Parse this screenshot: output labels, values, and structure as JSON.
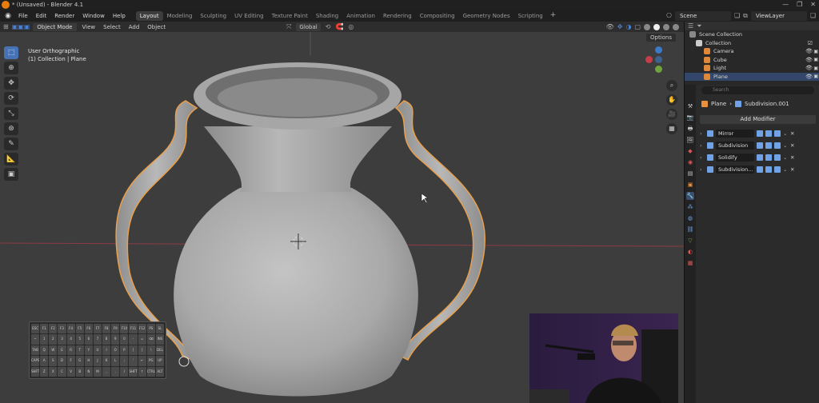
{
  "window": {
    "title": "* (Unsaved) - Blender 4.1",
    "controls": [
      "—",
      "❐",
      "✕"
    ]
  },
  "menu": [
    "File",
    "Edit",
    "Render",
    "Window",
    "Help"
  ],
  "workspaces": {
    "tabs": [
      "Layout",
      "Modeling",
      "Sculpting",
      "UV Editing",
      "Texture Paint",
      "Shading",
      "Animation",
      "Rendering",
      "Compositing",
      "Geometry Nodes",
      "Scripting"
    ],
    "active": "Layout",
    "add": "+"
  },
  "scene": {
    "label": "Scene",
    "view_layer": "ViewLayer"
  },
  "viewport_header": {
    "mode": "Object Mode",
    "menus": [
      "View",
      "Select",
      "Add",
      "Object"
    ],
    "transform_orientation": "Global",
    "options": "Options"
  },
  "viewport": {
    "view_name": "User Orthographic",
    "collection_info": "(1) Collection | Plane"
  },
  "keyboard": {
    "keys": [
      "ESC",
      "F1",
      "F2",
      "F3",
      "F4",
      "F5",
      "F6",
      "F7",
      "F8",
      "F9",
      "F10",
      "F11",
      "F12",
      "PS",
      "SL",
      "~",
      "1",
      "2",
      "3",
      "4",
      "5",
      "6",
      "7",
      "8",
      "9",
      "0",
      "-",
      "=",
      "⌫",
      "INS",
      "TAB",
      "Q",
      "W",
      "E",
      "R",
      "T",
      "Y",
      "U",
      "I",
      "O",
      "P",
      "[",
      "]",
      "\\",
      "DEL",
      "CAPS",
      "A",
      "S",
      "D",
      "F",
      "G",
      "H",
      "J",
      "K",
      "L",
      ";",
      "'",
      "↵",
      "PG",
      "UP",
      "SHFT",
      "Z",
      "X",
      "C",
      "V",
      "B",
      "N",
      "M",
      ",",
      ".",
      "/",
      "SHFT",
      "↑",
      "CTRL",
      "ALT"
    ]
  },
  "outliner": {
    "root": "Scene Collection",
    "collection": "Collection",
    "items": [
      {
        "name": "Camera",
        "color": "#e0883a"
      },
      {
        "name": "Cube",
        "color": "#e0883a"
      },
      {
        "name": "Light",
        "color": "#e0883a"
      },
      {
        "name": "Plane",
        "color": "#e0883a"
      }
    ],
    "selected": "Plane"
  },
  "properties": {
    "search_placeholder": "Search",
    "object": "Plane",
    "active_modifier": "Subdivision.001",
    "add_modifier": "Add Modifier",
    "modifiers": [
      "Mirror",
      "Subdivision",
      "Solidify",
      "Subdivision..."
    ]
  },
  "colors": {
    "accent": "#4772b3",
    "selection_outline": "#e8a04a",
    "axis_x": "#c93c4a",
    "axis_y": "#6ea33d",
    "axis_z": "#3d79c9"
  }
}
